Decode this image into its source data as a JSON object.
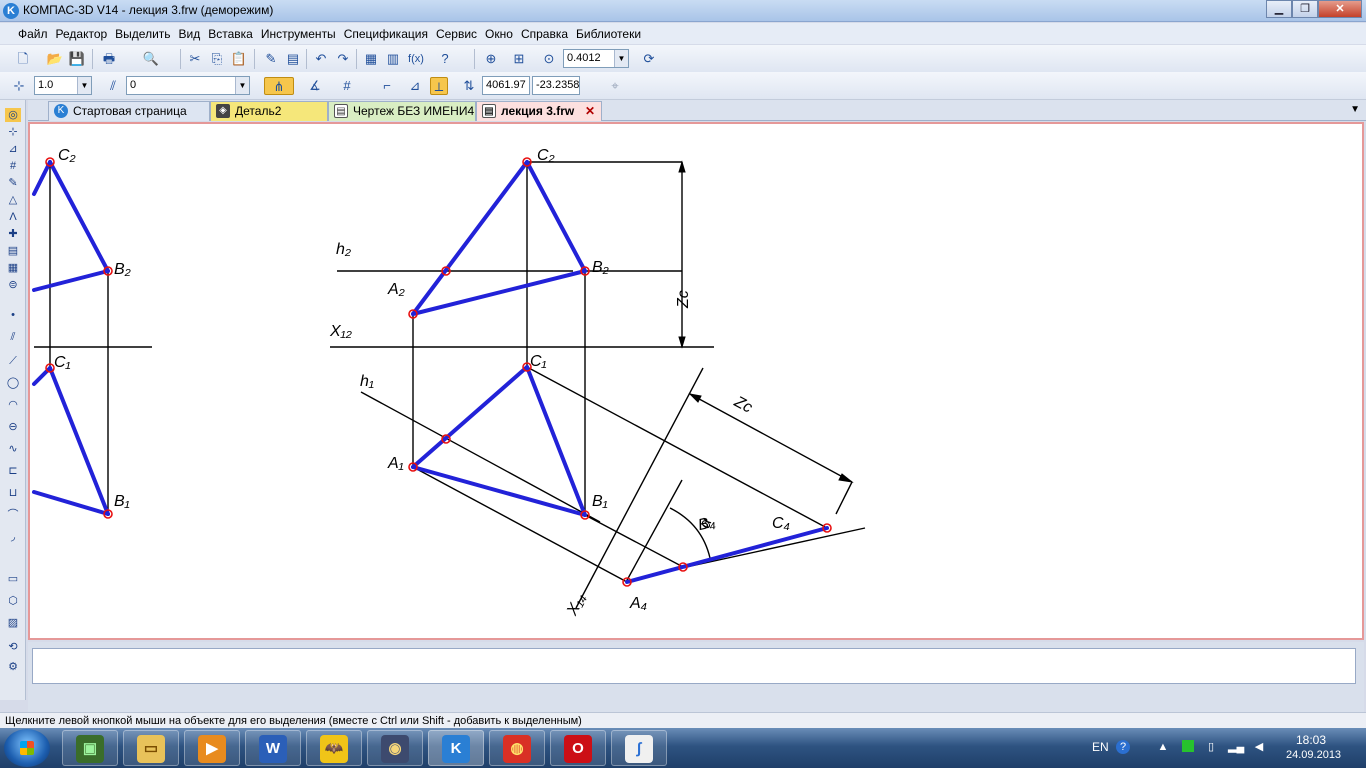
{
  "window": {
    "title": "КОМПАС-3D V14 - лекция 3.frw (деморежим)",
    "app_icon": "K",
    "buttons": {
      "minimize": "▁",
      "maximize": "❐",
      "close": "✕"
    }
  },
  "menu": [
    "Файл",
    "Редактор",
    "Выделить",
    "Вид",
    "Вставка",
    "Инструменты",
    "Спецификация",
    "Сервис",
    "Окно",
    "Справка",
    "Библиотеки"
  ],
  "toolbar1": {
    "icons": [
      "new-document-icon",
      "open-icon",
      "save-icon",
      "print-icon",
      "preview-icon",
      "cut-icon",
      "copy-icon",
      "paste-icon",
      "properties-icon",
      "manager-icon",
      "undo-icon",
      "redo-icon",
      "layers-icon",
      "variables-icon",
      "function-icon",
      "help-pointer-icon",
      "zoom-icon",
      "zoom-frame-icon",
      "zoom-all-icon",
      "refresh-icon"
    ],
    "glyphs": [
      "🗋",
      "📂",
      "💾",
      "🖶",
      "🔍",
      "✂",
      "⎘",
      "📋",
      "✎",
      "▤",
      "↶",
      "↷",
      "▦",
      "▥",
      "f(x)",
      "?",
      "⊕",
      "⊞",
      "⊙",
      "⟳"
    ],
    "zoom_value": "0.4012"
  },
  "toolbar2": {
    "step_value": "1.0",
    "layer_value": "0",
    "coord_x": "4061.97",
    "coord_y": "-23.2358",
    "glyphs": [
      "⊹",
      "⫽",
      "⋔",
      "∡",
      "#",
      "⌐",
      "⊿",
      "⟂",
      "⇅",
      "⌖"
    ]
  },
  "left_toolbar": {
    "icons": [
      "geometry-icon",
      "dimensions-icon",
      "designations-icon",
      "edit-icon",
      "parametrize-icon",
      "measure-icon",
      "select-icon",
      "spec-icon",
      "reports-icon",
      "insert-icon",
      "fragment-icon",
      "point-icon",
      "auxline-icon",
      "segment-icon",
      "circle-icon",
      "arc-icon",
      "ellipse-icon",
      "spline-icon",
      "polyline-icon",
      "fillet-icon",
      "chamfer-icon",
      "curve-icon",
      "rect-icon",
      "polygon-icon",
      "hatch-icon",
      "contour-icon",
      "tools-icon"
    ],
    "glyphs": [
      "◎",
      "⊹",
      "⊿",
      "#",
      "✎",
      "△",
      "Λ",
      "✚",
      "▤",
      "▦",
      "⊜",
      "•",
      "⫽",
      "⟋",
      "◯",
      "◠",
      "⊖",
      "∿",
      "⊏",
      "⊔",
      "⌒",
      "◞",
      "▭",
      "⬡",
      "▨",
      "⟲",
      "⚙"
    ]
  },
  "tabs": [
    {
      "label": "Стартовая страница",
      "icon": "home-icon",
      "glyph": "K",
      "active": false
    },
    {
      "label": "Деталь2",
      "icon": "part-icon",
      "glyph": "◈",
      "active": false
    },
    {
      "label": "Чертеж БЕЗ ИМЕНИ4",
      "icon": "drawing-icon",
      "glyph": "▤",
      "active": false
    },
    {
      "label": "лекция 3.frw",
      "icon": "fragment-icon",
      "glyph": "▤",
      "active": true
    }
  ],
  "tab_close": "✕",
  "tab_menu": "▼",
  "drawing": {
    "labels": {
      "c2_left": "C₂",
      "b2_left": "B₂",
      "c1_left": "C₁",
      "b1_left": "B₁",
      "c2": "C₂",
      "b2": "B₂",
      "a2": "A₂",
      "h2": "h₂",
      "x12": "X₁₂",
      "zc_vert": "Zc",
      "c1": "C₁",
      "h1": "h₁",
      "a1": "A₁",
      "b1": "B₁",
      "zc_diag": "Zc",
      "alpha": "α",
      "c4": "C₄",
      "b4": "B₄",
      "a4": "A₄",
      "x14": "X₁₄"
    },
    "colors": {
      "edges": "#2222d8",
      "points": "#e81010",
      "lines": "#000000"
    }
  },
  "status": "Щелкните левой кнопкой мыши на объекте для его выделения (вместе с Ctrl или Shift - добавить к выделенным)",
  "taskbar": {
    "apps": [
      {
        "name": "ide-app",
        "glyph": "▣",
        "bg": "#3a6d2a",
        "color": "#9cf39c"
      },
      {
        "name": "explorer-app",
        "glyph": "▭",
        "bg": "#e8c25a",
        "color": "#7a4d00"
      },
      {
        "name": "media-app",
        "glyph": "▶",
        "bg": "#e88b1e",
        "color": "#ffffff"
      },
      {
        "name": "word-app",
        "glyph": "W",
        "bg": "#2b5fb8",
        "color": "#ffffff"
      },
      {
        "name": "bat-app",
        "glyph": "🦇",
        "bg": "#f0c418",
        "color": "#000000"
      },
      {
        "name": "dvd-app",
        "glyph": "◉",
        "bg": "#3d4a6e",
        "color": "#f5d67a"
      },
      {
        "name": "kompas-app",
        "glyph": "K",
        "bg": "#2a7fd4",
        "color": "#ffffff"
      },
      {
        "name": "chrome-app",
        "glyph": "◍",
        "bg": "#d93025",
        "color": "#ffe36b"
      },
      {
        "name": "opera-app",
        "glyph": "O",
        "bg": "#cc0f16",
        "color": "#ffffff"
      },
      {
        "name": "mathcad-app",
        "glyph": "∫",
        "bg": "#f0f0f0",
        "color": "#2a6fd4"
      }
    ],
    "lang": "EN",
    "time": "18:03",
    "date": "24.09.2013"
  }
}
